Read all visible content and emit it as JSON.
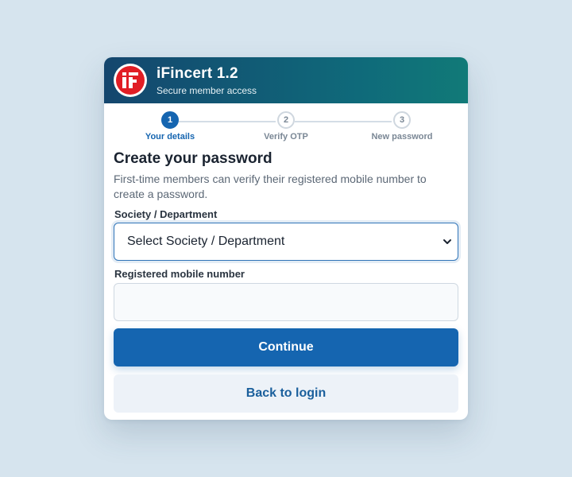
{
  "header": {
    "app_title": "iFincert 1.2",
    "subtitle": "Secure member access",
    "logo_icon": "ifincert-logo-icon"
  },
  "stepper": {
    "steps": [
      {
        "number": "1",
        "label": "Your details",
        "state": "active"
      },
      {
        "number": "2",
        "label": "Verify OTP",
        "state": "inactive"
      },
      {
        "number": "3",
        "label": "New password",
        "state": "inactive"
      }
    ]
  },
  "form": {
    "heading": "Create your password",
    "description": "First-time members can verify their registered mobile number to create a password.",
    "society_label": "Society / Department",
    "society_selected": "Select Society / Department",
    "mobile_label": "Registered mobile number",
    "mobile_value": "",
    "continue_label": "Continue",
    "back_label": "Back to login"
  },
  "colors": {
    "primary": "#1565b0",
    "header_start": "#14466e",
    "header_end": "#117a78",
    "logo_red": "#e11d25",
    "background": "#d6e4ee"
  }
}
